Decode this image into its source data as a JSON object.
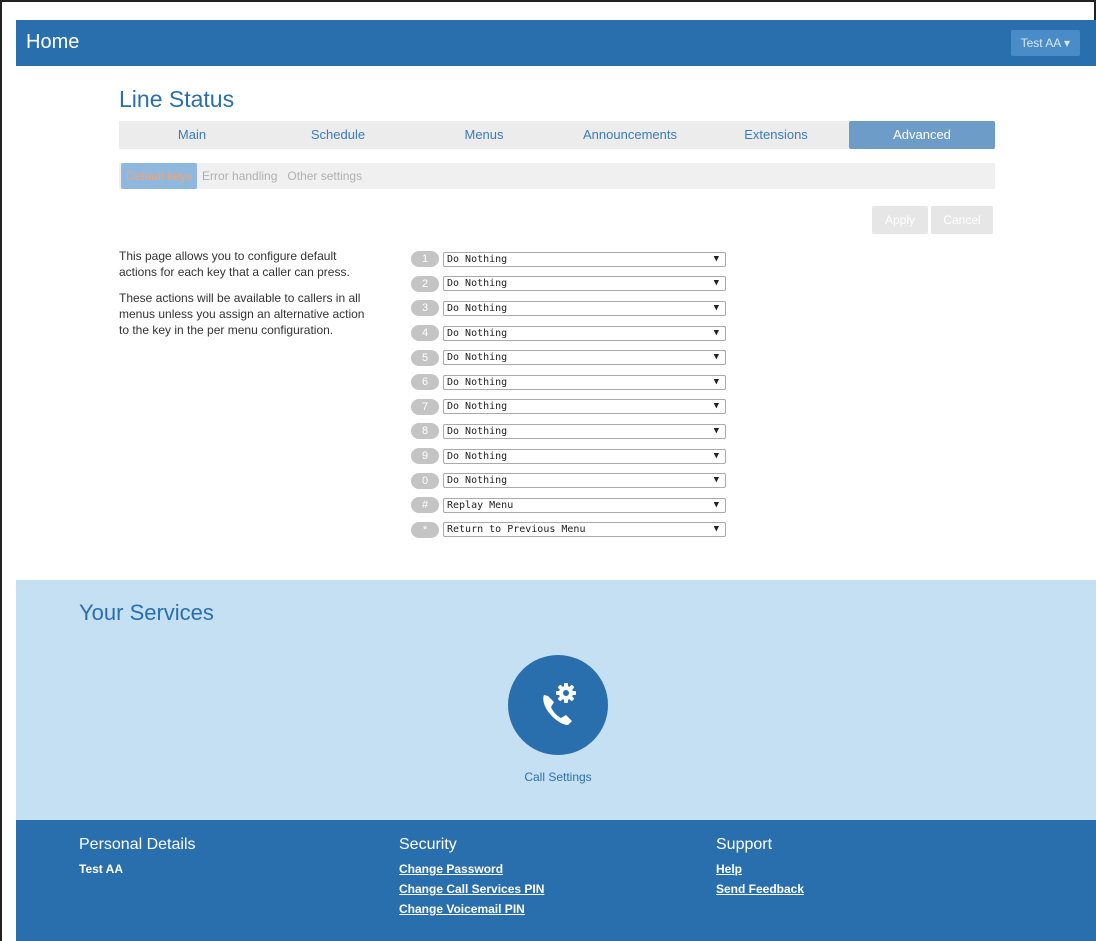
{
  "header": {
    "home_label": "Home",
    "user_menu": "Test AA ▾"
  },
  "page": {
    "title": "Line Status"
  },
  "tabs": [
    {
      "label": "Main"
    },
    {
      "label": "Schedule"
    },
    {
      "label": "Menus"
    },
    {
      "label": "Announcements"
    },
    {
      "label": "Extensions"
    },
    {
      "label": "Advanced",
      "active": true
    }
  ],
  "subtabs": [
    {
      "label": "Default keys",
      "active": true
    },
    {
      "label": "Error handling"
    },
    {
      "label": "Other settings"
    }
  ],
  "actions": {
    "apply": "Apply",
    "cancel": "Cancel"
  },
  "description": {
    "p1": "This page allows you to configure default actions for each key that a caller can press.",
    "p2": "These actions will be available to callers in all menus unless you assign an alternative action to the key in the per menu configuration."
  },
  "keys": [
    {
      "key": "1",
      "action": "Do Nothing"
    },
    {
      "key": "2",
      "action": "Do Nothing"
    },
    {
      "key": "3",
      "action": "Do Nothing"
    },
    {
      "key": "4",
      "action": "Do Nothing"
    },
    {
      "key": "5",
      "action": "Do Nothing"
    },
    {
      "key": "6",
      "action": "Do Nothing"
    },
    {
      "key": "7",
      "action": "Do Nothing"
    },
    {
      "key": "8",
      "action": "Do Nothing"
    },
    {
      "key": "9",
      "action": "Do Nothing"
    },
    {
      "key": "0",
      "action": "Do Nothing"
    },
    {
      "key": "#",
      "action": "Replay Menu"
    },
    {
      "key": "*",
      "action": "Return to Previous Menu"
    }
  ],
  "services": {
    "title": "Your Services",
    "items": [
      {
        "label": "Call Settings",
        "icon": "phone-gear-icon"
      }
    ]
  },
  "footer": {
    "personal": {
      "heading": "Personal Details",
      "name": "Test AA"
    },
    "security": {
      "heading": "Security",
      "links": [
        "Change Password",
        "Change Call Services PIN",
        "Change Voicemail PIN"
      ]
    },
    "support": {
      "heading": "Support",
      "links": [
        "Help",
        "Send Feedback"
      ]
    }
  },
  "colors": {
    "brand": "#2a6fad",
    "services_bg": "#c5e0f2",
    "active_tab": "#6d9cc9"
  }
}
